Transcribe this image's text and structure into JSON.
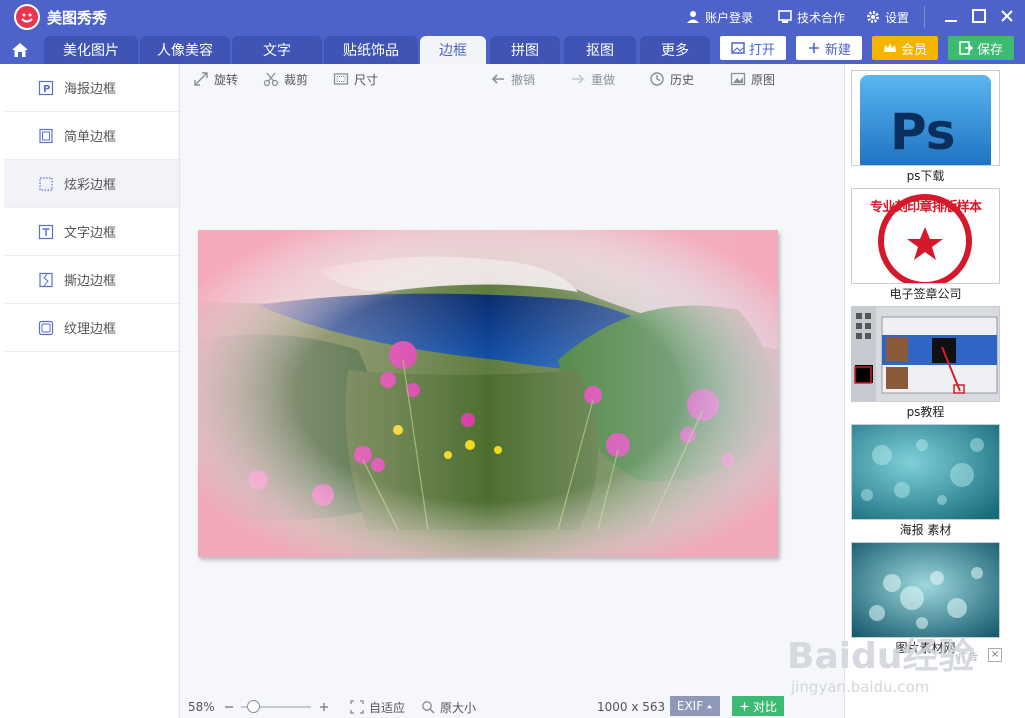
{
  "titlebar": {
    "app_title": "美图秀秀",
    "account_login": "账户登录",
    "tech_coop": "技术合作",
    "settings": "设置"
  },
  "tabs": [
    {
      "label": "美化图片"
    },
    {
      "label": "人像美容"
    },
    {
      "label": "文字"
    },
    {
      "label": "贴纸饰品"
    },
    {
      "label": "边框"
    },
    {
      "label": "拼图"
    },
    {
      "label": "抠图"
    },
    {
      "label": "更多"
    }
  ],
  "active_tab": "边框",
  "toolbar_buttons": {
    "open": "打开",
    "new": "新建",
    "vip": "会员",
    "save": "保存"
  },
  "sidebar": {
    "items": [
      {
        "label": "海报边框",
        "icon": "poster-frame-icon"
      },
      {
        "label": "简单边框",
        "icon": "simple-frame-icon"
      },
      {
        "label": "炫彩边框",
        "icon": "colorful-frame-icon"
      },
      {
        "label": "文字边框",
        "icon": "text-frame-icon"
      },
      {
        "label": "撕边边框",
        "icon": "torn-frame-icon"
      },
      {
        "label": "纹理边框",
        "icon": "texture-frame-icon"
      }
    ],
    "selected": "炫彩边框"
  },
  "canvas_tools": {
    "rotate": "旋转",
    "crop": "裁剪",
    "size": "尺寸",
    "undo": "撤销",
    "redo": "重做",
    "history": "历史",
    "original": "原图"
  },
  "statusbar": {
    "zoom": "58%",
    "fit": "自适应",
    "actual_size": "原大小",
    "dimensions": "1000 x 563",
    "exif": "EXIF",
    "compare": "对比"
  },
  "ads": [
    {
      "caption": "ps下载",
      "thumb_text": "Ps"
    },
    {
      "caption": "电子签章公司",
      "thumb_text": "专业刻印章排版样本"
    },
    {
      "caption": "ps教程"
    },
    {
      "caption": "海报 素材"
    },
    {
      "caption": "图片素材网"
    }
  ],
  "ad_marker": "广告",
  "watermark": {
    "brand": "Baidu经验",
    "url": "jingyan.baidu.com"
  },
  "colors": {
    "brand_blue": "#4d63c9",
    "vip_gold": "#f5b400",
    "save_green": "#3dbb73",
    "logo_red": "#e8364f"
  }
}
